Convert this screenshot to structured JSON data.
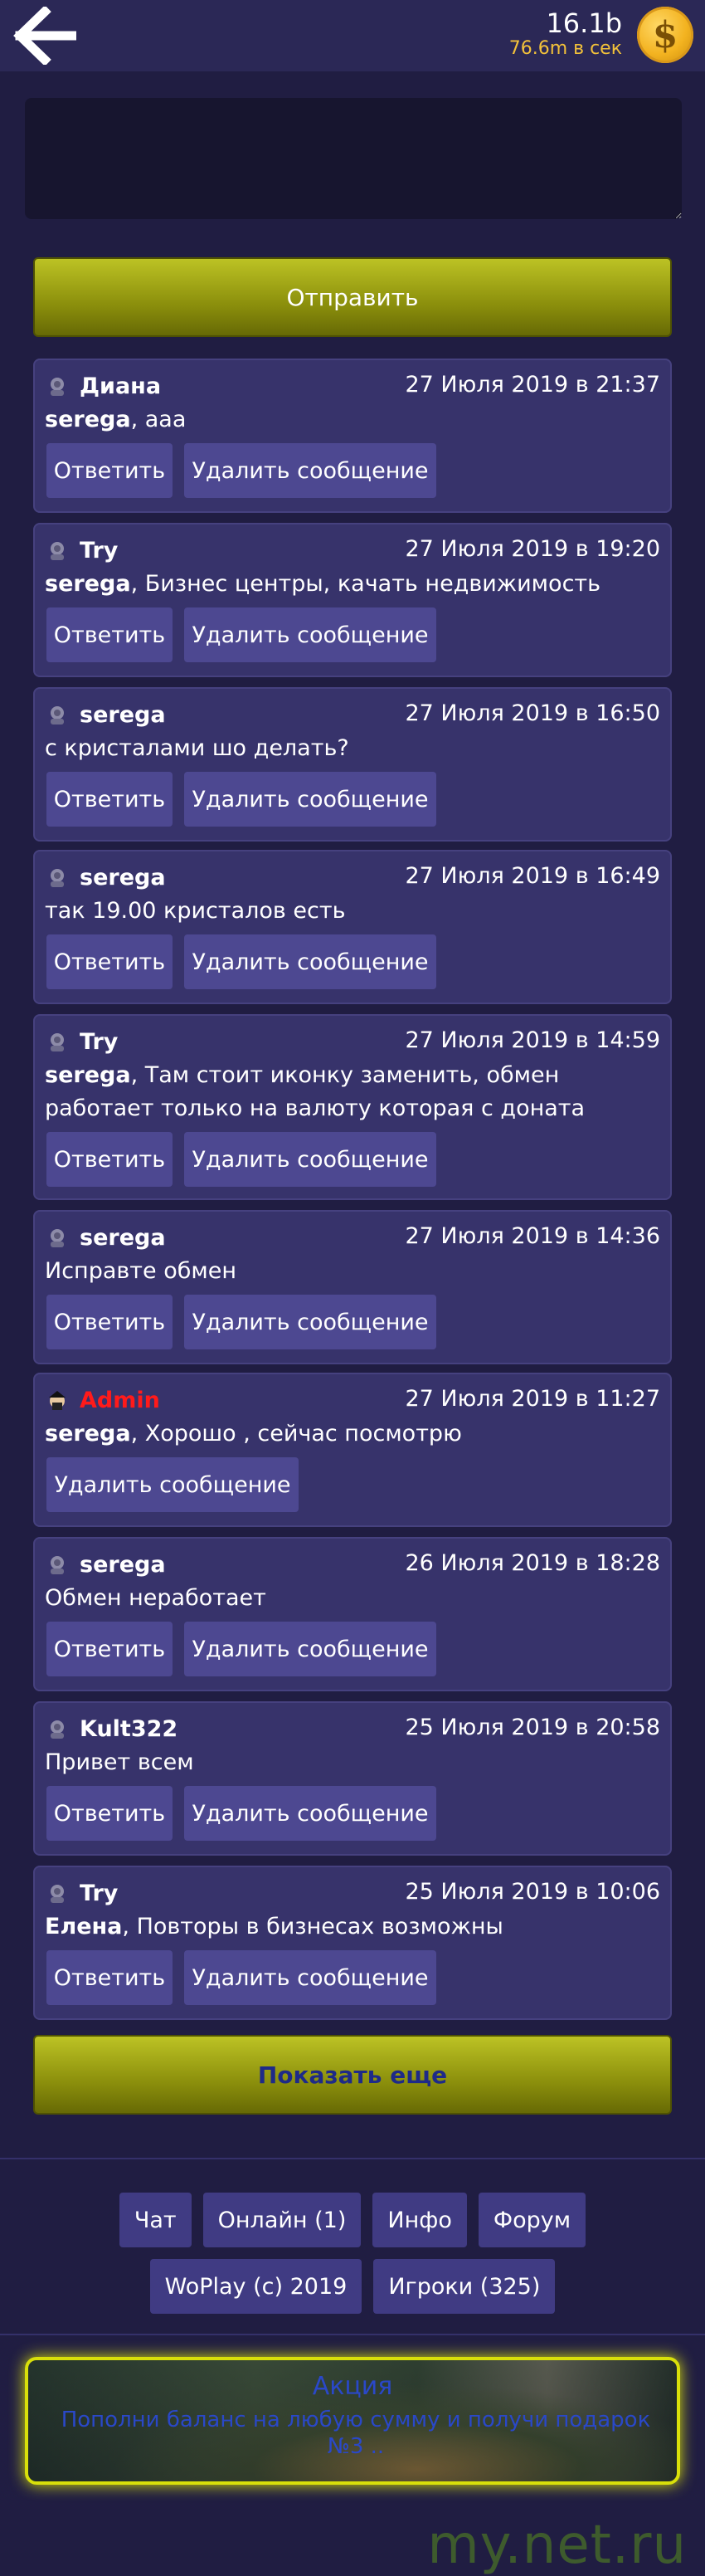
{
  "header": {
    "back_icon": "arrow-left-icon",
    "balance": "16.1b",
    "rate": "76.6m в сек",
    "coin_icon": "dollar-coin-icon",
    "coin_symbol": "$"
  },
  "composer": {
    "input_value": "",
    "send_label": "Отправить"
  },
  "labels": {
    "reply": "Ответить",
    "delete": "Удалить сообщение",
    "show_more": "Показать еще"
  },
  "messages": [
    {
      "author": "Диана",
      "date": "27 Июля 2019 в 21:37",
      "mention": "serega",
      "text": ", ааа"
    },
    {
      "author": "Try",
      "date": "27 Июля 2019 в 19:20",
      "mention": "serega",
      "text": ", Бизнес центры, качать недвижимость"
    },
    {
      "author": "serega",
      "date": "27 Июля 2019 в 16:50",
      "mention": "",
      "text": "с кристалами шо делать?"
    },
    {
      "author": "serega",
      "date": "27 Июля 2019 в 16:49",
      "mention": "",
      "text": "так 19.00 кристалов есть"
    },
    {
      "author": "Try",
      "date": "27 Июля 2019 в 14:59",
      "mention": "serega",
      "text": ", Там стоит иконку заменить, обмен работает только на валюту которая с доната"
    },
    {
      "author": "serega",
      "date": "27 Июля 2019 в 14:36",
      "mention": "",
      "text": "Исправте обмен"
    },
    {
      "author": "Admin",
      "date": "27 Июля 2019 в 11:27",
      "mention": "serega",
      "text": ", Хорошо , сейчас посмотрю"
    },
    {
      "author": "serega",
      "date": "26 Июля 2019 в 18:28",
      "mention": "",
      "text": "Обмен неработает"
    },
    {
      "author": "Kult322",
      "date": "25 Июля 2019 в 20:58",
      "mention": "",
      "text": "Привет всем"
    },
    {
      "author": "Try",
      "date": "25 Июля 2019 в 10:06",
      "mention": "Елена",
      "text": ", Повторы в бизнесах возможны"
    }
  ],
  "footer": {
    "chat": "Чат",
    "online": "Онлайн (1)",
    "info": "Инфо",
    "forum": "Форум",
    "copyright": "WoPlay (c) 2019",
    "players": "Игроки (325)"
  },
  "promo": {
    "title": "Акция",
    "text": "Пополни баланс на любую сумму и получи подарок №3 .."
  },
  "watermark": "my.net.ru",
  "colors": {
    "background": "#201d42",
    "card": "#37336b",
    "button_yellow": "#a7ad1a",
    "admin_name": "#ff1a1a",
    "rate_text": "#f2c13a"
  }
}
